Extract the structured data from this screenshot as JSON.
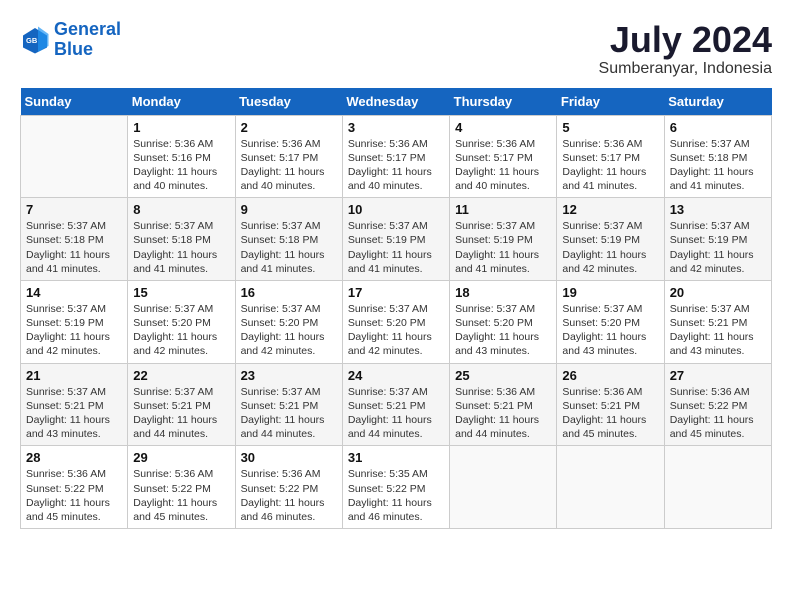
{
  "logo": {
    "line1": "General",
    "line2": "Blue"
  },
  "title": "July 2024",
  "subtitle": "Sumberanyar, Indonesia",
  "weekdays": [
    "Sunday",
    "Monday",
    "Tuesday",
    "Wednesday",
    "Thursday",
    "Friday",
    "Saturday"
  ],
  "weeks": [
    [
      {
        "day": "",
        "info": ""
      },
      {
        "day": "1",
        "info": "Sunrise: 5:36 AM\nSunset: 5:16 PM\nDaylight: 11 hours\nand 40 minutes."
      },
      {
        "day": "2",
        "info": "Sunrise: 5:36 AM\nSunset: 5:17 PM\nDaylight: 11 hours\nand 40 minutes."
      },
      {
        "day": "3",
        "info": "Sunrise: 5:36 AM\nSunset: 5:17 PM\nDaylight: 11 hours\nand 40 minutes."
      },
      {
        "day": "4",
        "info": "Sunrise: 5:36 AM\nSunset: 5:17 PM\nDaylight: 11 hours\nand 40 minutes."
      },
      {
        "day": "5",
        "info": "Sunrise: 5:36 AM\nSunset: 5:17 PM\nDaylight: 11 hours\nand 41 minutes."
      },
      {
        "day": "6",
        "info": "Sunrise: 5:37 AM\nSunset: 5:18 PM\nDaylight: 11 hours\nand 41 minutes."
      }
    ],
    [
      {
        "day": "7",
        "info": "Sunrise: 5:37 AM\nSunset: 5:18 PM\nDaylight: 11 hours\nand 41 minutes."
      },
      {
        "day": "8",
        "info": "Sunrise: 5:37 AM\nSunset: 5:18 PM\nDaylight: 11 hours\nand 41 minutes."
      },
      {
        "day": "9",
        "info": "Sunrise: 5:37 AM\nSunset: 5:18 PM\nDaylight: 11 hours\nand 41 minutes."
      },
      {
        "day": "10",
        "info": "Sunrise: 5:37 AM\nSunset: 5:19 PM\nDaylight: 11 hours\nand 41 minutes."
      },
      {
        "day": "11",
        "info": "Sunrise: 5:37 AM\nSunset: 5:19 PM\nDaylight: 11 hours\nand 41 minutes."
      },
      {
        "day": "12",
        "info": "Sunrise: 5:37 AM\nSunset: 5:19 PM\nDaylight: 11 hours\nand 42 minutes."
      },
      {
        "day": "13",
        "info": "Sunrise: 5:37 AM\nSunset: 5:19 PM\nDaylight: 11 hours\nand 42 minutes."
      }
    ],
    [
      {
        "day": "14",
        "info": "Sunrise: 5:37 AM\nSunset: 5:19 PM\nDaylight: 11 hours\nand 42 minutes."
      },
      {
        "day": "15",
        "info": "Sunrise: 5:37 AM\nSunset: 5:20 PM\nDaylight: 11 hours\nand 42 minutes."
      },
      {
        "day": "16",
        "info": "Sunrise: 5:37 AM\nSunset: 5:20 PM\nDaylight: 11 hours\nand 42 minutes."
      },
      {
        "day": "17",
        "info": "Sunrise: 5:37 AM\nSunset: 5:20 PM\nDaylight: 11 hours\nand 42 minutes."
      },
      {
        "day": "18",
        "info": "Sunrise: 5:37 AM\nSunset: 5:20 PM\nDaylight: 11 hours\nand 43 minutes."
      },
      {
        "day": "19",
        "info": "Sunrise: 5:37 AM\nSunset: 5:20 PM\nDaylight: 11 hours\nand 43 minutes."
      },
      {
        "day": "20",
        "info": "Sunrise: 5:37 AM\nSunset: 5:21 PM\nDaylight: 11 hours\nand 43 minutes."
      }
    ],
    [
      {
        "day": "21",
        "info": "Sunrise: 5:37 AM\nSunset: 5:21 PM\nDaylight: 11 hours\nand 43 minutes."
      },
      {
        "day": "22",
        "info": "Sunrise: 5:37 AM\nSunset: 5:21 PM\nDaylight: 11 hours\nand 44 minutes."
      },
      {
        "day": "23",
        "info": "Sunrise: 5:37 AM\nSunset: 5:21 PM\nDaylight: 11 hours\nand 44 minutes."
      },
      {
        "day": "24",
        "info": "Sunrise: 5:37 AM\nSunset: 5:21 PM\nDaylight: 11 hours\nand 44 minutes."
      },
      {
        "day": "25",
        "info": "Sunrise: 5:36 AM\nSunset: 5:21 PM\nDaylight: 11 hours\nand 44 minutes."
      },
      {
        "day": "26",
        "info": "Sunrise: 5:36 AM\nSunset: 5:21 PM\nDaylight: 11 hours\nand 45 minutes."
      },
      {
        "day": "27",
        "info": "Sunrise: 5:36 AM\nSunset: 5:22 PM\nDaylight: 11 hours\nand 45 minutes."
      }
    ],
    [
      {
        "day": "28",
        "info": "Sunrise: 5:36 AM\nSunset: 5:22 PM\nDaylight: 11 hours\nand 45 minutes."
      },
      {
        "day": "29",
        "info": "Sunrise: 5:36 AM\nSunset: 5:22 PM\nDaylight: 11 hours\nand 45 minutes."
      },
      {
        "day": "30",
        "info": "Sunrise: 5:36 AM\nSunset: 5:22 PM\nDaylight: 11 hours\nand 46 minutes."
      },
      {
        "day": "31",
        "info": "Sunrise: 5:35 AM\nSunset: 5:22 PM\nDaylight: 11 hours\nand 46 minutes."
      },
      {
        "day": "",
        "info": ""
      },
      {
        "day": "",
        "info": ""
      },
      {
        "day": "",
        "info": ""
      }
    ]
  ]
}
